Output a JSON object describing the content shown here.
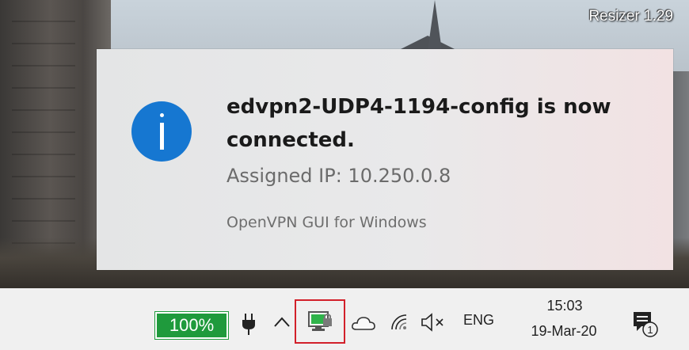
{
  "overlay": {
    "resizer_label": "Resizer 1.29"
  },
  "toast": {
    "icon": "info-icon",
    "title": "edvpn2-UDP4-1194-config is now connected.",
    "message": "Assigned IP: 10.250.0.8",
    "app_name": "OpenVPN GUI for Windows",
    "accent_color": "#1677d1"
  },
  "taskbar": {
    "battery_percent": "100%",
    "battery_color": "#1f9a3c",
    "icons": [
      "plug-icon",
      "chevron-up-icon",
      "openvpn-tray-icon",
      "onedrive-cloud-icon",
      "wifi-icon",
      "volume-muted-icon",
      "notifications-icon"
    ],
    "highlight_color": "#d2202a",
    "language": "ENG",
    "time": "15:03",
    "date": "19-Mar-20",
    "notification_count": "1"
  }
}
